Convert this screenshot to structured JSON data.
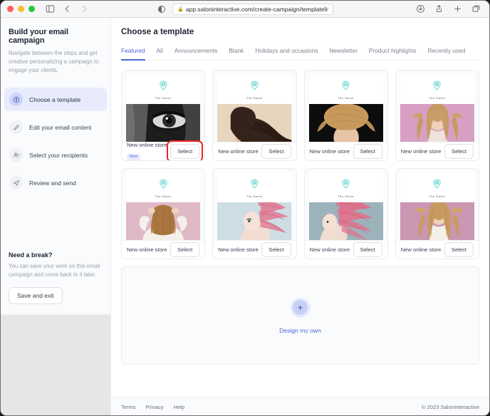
{
  "browser": {
    "url": "app.saloninteractive.com/create-campaign/templates",
    "lock_icon": "lock-icon",
    "reload_icon": "reload-icon",
    "reader_icon": "reader-view-icon",
    "back_icon": "back-arrow-icon",
    "forward_icon": "forward-arrow-icon",
    "sidebar_icon": "sidebar-toggle-icon",
    "right_icons": [
      "download-icon",
      "share-icon",
      "new-tab-icon",
      "tab-overview-icon"
    ]
  },
  "sidebar": {
    "title": "Build your email campaign",
    "subtitle": "Navigate between the steps and get creative personalizing a campaign to engage your clients.",
    "items": [
      {
        "label": "Choose a template",
        "icon": "palette-icon",
        "active": true
      },
      {
        "label": "Edit your email content",
        "icon": "pencil-icon",
        "active": false
      },
      {
        "label": "Select your recipients",
        "icon": "people-icon",
        "active": false
      },
      {
        "label": "Review and send",
        "icon": "paper-plane-icon",
        "active": false
      }
    ],
    "break": {
      "title": "Need a break?",
      "text": "You can save your work on this email campaign and come back to it later.",
      "button": "Save and exit"
    }
  },
  "main": {
    "title": "Choose a template",
    "tabs": [
      {
        "label": "Featured",
        "active": true
      },
      {
        "label": "All",
        "active": false
      },
      {
        "label": "Announcements",
        "active": false
      },
      {
        "label": "Blank",
        "active": false
      },
      {
        "label": "Holidays and occasions",
        "active": false
      },
      {
        "label": "Newsletter",
        "active": false
      },
      {
        "label": "Product highlights",
        "active": false
      },
      {
        "label": "Recently used",
        "active": false
      }
    ],
    "logo_text": "The Salon",
    "select_label": "Select",
    "cards": [
      {
        "name": "New online store",
        "badge": "New",
        "highlighted": true,
        "image": "woman-eye-closeup-bw",
        "bg": "#1d1d1d",
        "accent": "#bdbdbd"
      },
      {
        "name": "New online store",
        "badge": "",
        "highlighted": false,
        "image": "woman-long-curly-dark-hair",
        "bg": "#e6d3bb",
        "accent": "#3a2a20"
      },
      {
        "name": "New online store",
        "badge": "",
        "highlighted": false,
        "image": "blonde-hair-dark-background",
        "bg": "#111111",
        "accent": "#c59a5e"
      },
      {
        "name": "New online store",
        "badge": "",
        "highlighted": false,
        "image": "blonde-woman-pink-background",
        "bg": "#d9a3c4",
        "accent": "#c8a06a"
      },
      {
        "name": "New online store",
        "badge": "",
        "highlighted": false,
        "image": "woman-back-pink-background",
        "bg": "#e3bcc8",
        "accent": "#a8763f"
      },
      {
        "name": "New online store",
        "badge": "",
        "highlighted": false,
        "image": "pink-feather-headdress",
        "bg": "#cfdde3",
        "accent": "#e0788f"
      },
      {
        "name": "New online store",
        "badge": "",
        "highlighted": false,
        "image": "pink-feathers-profile",
        "bg": "#9fb4bd",
        "accent": "#e2708a"
      },
      {
        "name": "New online store",
        "badge": "",
        "highlighted": false,
        "image": "blonde-woman-mauve-backdrop",
        "bg": "#cb9ab5",
        "accent": "#c99a60"
      }
    ],
    "design_own": {
      "label": "Design my own",
      "icon": "plus-icon"
    }
  },
  "footer": {
    "links": [
      "Terms",
      "Privacy",
      "Help"
    ],
    "copyright": "© 2023 SalonInteractive"
  },
  "colors": {
    "accent": "#4f63d2",
    "badge_bg": "#e7ebfb",
    "highlight": "#ef2525",
    "logo": "#3fc9c6"
  }
}
